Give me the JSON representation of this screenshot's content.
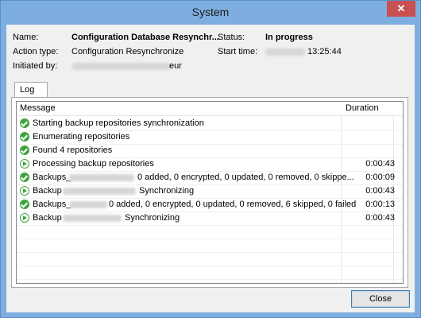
{
  "window": {
    "title": "System",
    "close_glyph": "✕"
  },
  "info": {
    "name_label": "Name:",
    "name_value": "Configuration Database Resynchr...",
    "action_label": "Action type:",
    "action_value": "Configuration Resynchronize",
    "initiated_label": "Initiated by:",
    "initiated_suffix": "eur",
    "status_label": "Status:",
    "status_value": "In progress",
    "start_label": "Start time:",
    "start_time": "13:25:44"
  },
  "tabs": [
    {
      "label": "Log"
    }
  ],
  "log": {
    "columns": {
      "message": "Message",
      "duration": "Duration"
    },
    "rows": [
      {
        "status": "success",
        "icon": "success-check-icon",
        "text": "Starting backup repositories synchronization",
        "duration": ""
      },
      {
        "status": "success",
        "icon": "success-check-icon",
        "text": "Enumerating repositories",
        "duration": ""
      },
      {
        "status": "success",
        "icon": "success-check-icon",
        "text": "Found 4 repositories",
        "duration": ""
      },
      {
        "status": "running",
        "icon": "running-play-icon",
        "text": "Processing backup repositories",
        "duration": "0:00:43"
      },
      {
        "status": "success",
        "icon": "success-check-icon",
        "prefix": "Backups_",
        "suffix": "0 added, 0 encrypted, 0 updated, 0 removed, 0 skippe...",
        "duration": "0:00:09"
      },
      {
        "status": "running",
        "icon": "running-play-icon",
        "prefix": "Backup",
        "suffix": "Synchronizing",
        "duration": "0:00:43"
      },
      {
        "status": "success",
        "icon": "success-check-icon",
        "prefix": "Backups_",
        "suffix": "0 added, 0 encrypted, 0 updated, 0 removed, 6 skipped, 0 failed",
        "duration": "0:00:13"
      },
      {
        "status": "running",
        "icon": "running-play-icon",
        "prefix": "Backup",
        "suffix": "Synchronizing",
        "duration": "0:00:43"
      }
    ]
  },
  "buttons": {
    "close_label": "Close"
  }
}
